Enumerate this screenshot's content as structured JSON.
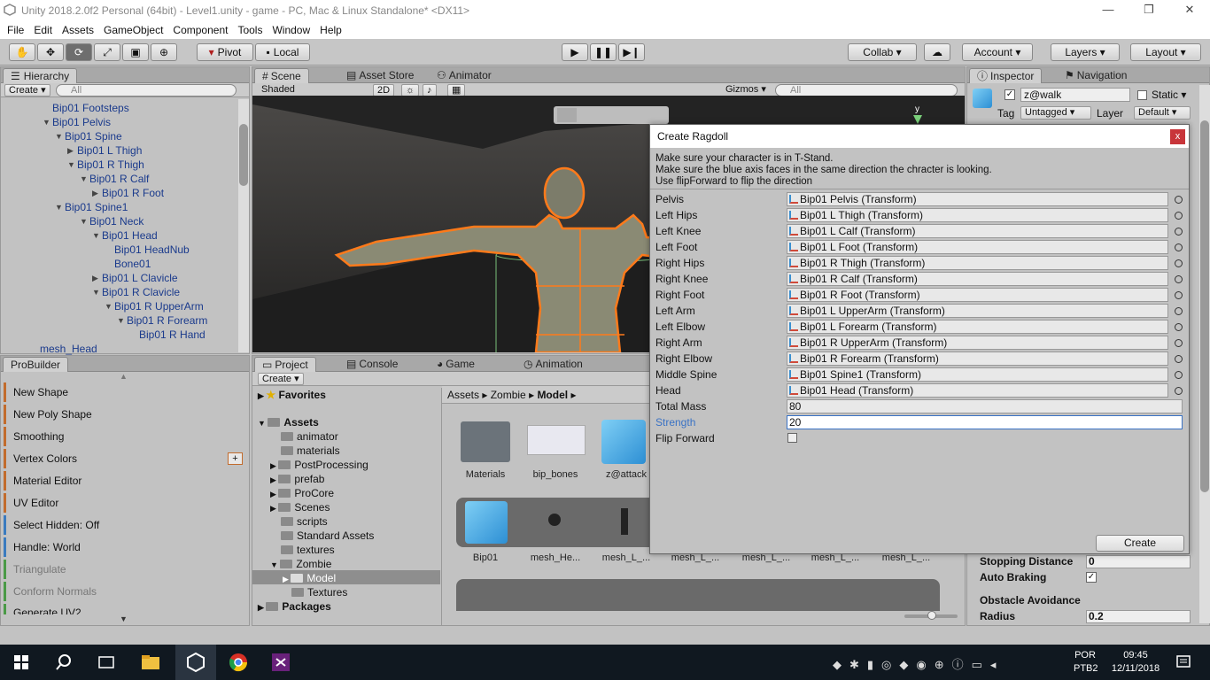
{
  "window": {
    "title": "Unity 2018.2.0f2 Personal (64bit) - Level1.unity - game - PC, Mac & Linux Standalone* <DX11>",
    "minimize": "—",
    "restore": "❐",
    "close": "✕"
  },
  "menu": [
    "File",
    "Edit",
    "Assets",
    "GameObject",
    "Component",
    "Tools",
    "Window",
    "Help"
  ],
  "toolbar": {
    "pivot": "Pivot",
    "local": "Local",
    "collab": "Collab ▾",
    "account": "Account ▾",
    "layers": "Layers ▾",
    "layout": "Layout ▾"
  },
  "hierarchy": {
    "tab": "Hierarchy",
    "create": "Create ▾",
    "search_placeholder": "All",
    "items": [
      "Bip01 Footsteps",
      "Bip01 Pelvis",
      "Bip01 Spine",
      "Bip01 L Thigh",
      "Bip01 R Thigh",
      "Bip01 R Calf",
      "Bip01 R Foot",
      "Bip01 Spine1",
      "Bip01 Neck",
      "Bip01 Head",
      "Bip01 HeadNub",
      "Bone01",
      "Bip01 L Clavicle",
      "Bip01 R Clavicle",
      "Bip01 R UpperArm",
      "Bip01 R Forearm",
      "Bip01 R Hand",
      "mesh_Head"
    ]
  },
  "scene": {
    "tabs": [
      "Scene",
      "Asset Store",
      "Animator"
    ],
    "shading": "Shaded",
    "mode2d": "2D",
    "gizmos": "Gizmos ▾",
    "search_placeholder": "All",
    "axis": "y"
  },
  "probuilder": {
    "tab": "ProBuilder",
    "items": [
      "New Shape",
      "New Poly Shape",
      "Smoothing",
      "Vertex Colors",
      "Material Editor",
      "UV Editor",
      "Select Hidden: Off",
      "Handle: World",
      "Triangulate",
      "Conform Normals",
      "Generate UV2"
    ],
    "plus": "+"
  },
  "project": {
    "tabs": [
      "Project",
      "Console",
      "Game",
      "Animation"
    ],
    "create": "Create ▾",
    "favorites": "Favorites",
    "assets": "Assets",
    "folders": [
      "animator",
      "materials",
      "PostProcessing",
      "prefab",
      "ProCore",
      "Scenes",
      "scripts",
      "Standard Assets",
      "textures",
      "Zombie",
      "Model",
      "Textures"
    ],
    "packages": "Packages",
    "breadcrumb": [
      "Assets",
      "Zombie",
      "Model"
    ],
    "grid_row1": [
      "Materials",
      "bip_bones",
      "z@attack"
    ],
    "grid_row2": [
      "Bip01",
      "mesh_He...",
      "mesh_L_...",
      "mesh_L_...",
      "mesh_L_...",
      "mesh_L_...",
      "mesh_L_..."
    ]
  },
  "inspector": {
    "tabs": [
      "Inspector",
      "Navigation"
    ],
    "object_name": "z@walk",
    "static": "Static",
    "tag_label": "Tag",
    "tag": "Untagged",
    "layer_label": "Layer",
    "layer": "Default",
    "stopping_distance_label": "Stopping Distance",
    "stopping_distance": "0",
    "auto_braking_label": "Auto Braking",
    "obstacle_avoidance": "Obstacle Avoidance",
    "radius_label": "Radius",
    "radius": "0.2"
  },
  "dialog": {
    "title": "Create Ragdoll",
    "close": "x",
    "help": [
      "Make sure your character is in T-Stand.",
      "Make sure the blue axis faces in the same direction the chracter is looking.",
      "Use flipForward to flip the direction"
    ],
    "fields": [
      {
        "label": "Pelvis",
        "value": "Bip01 Pelvis (Transform)"
      },
      {
        "label": "Left Hips",
        "value": "Bip01 L Thigh (Transform)"
      },
      {
        "label": "Left Knee",
        "value": "Bip01 L Calf (Transform)"
      },
      {
        "label": "Left Foot",
        "value": "Bip01 L Foot (Transform)"
      },
      {
        "label": "Right Hips",
        "value": "Bip01 R Thigh (Transform)"
      },
      {
        "label": "Right Knee",
        "value": "Bip01 R Calf (Transform)"
      },
      {
        "label": "Right Foot",
        "value": "Bip01 R Foot (Transform)"
      },
      {
        "label": "Left Arm",
        "value": "Bip01 L UpperArm (Transform)"
      },
      {
        "label": "Left Elbow",
        "value": "Bip01 L Forearm (Transform)"
      },
      {
        "label": "Right Arm",
        "value": "Bip01 R UpperArm (Transform)"
      },
      {
        "label": "Right Elbow",
        "value": "Bip01 R Forearm (Transform)"
      },
      {
        "label": "Middle Spine",
        "value": "Bip01 Spine1 (Transform)"
      },
      {
        "label": "Head",
        "value": "Bip01 Head (Transform)"
      }
    ],
    "total_mass_label": "Total Mass",
    "total_mass": "80",
    "strength_label": "Strength",
    "strength": "20",
    "flip_forward_label": "Flip Forward",
    "create_button": "Create"
  },
  "taskbar": {
    "lang1": "POR",
    "lang2": "PTB2",
    "time": "09:45",
    "date": "12/11/2018"
  },
  "colors": {
    "accent_orange": "#c26b2c",
    "selection_blue": "#3a72c4",
    "unity_dark": "#2e2e2e",
    "tree_text": "#1a3a8c"
  }
}
